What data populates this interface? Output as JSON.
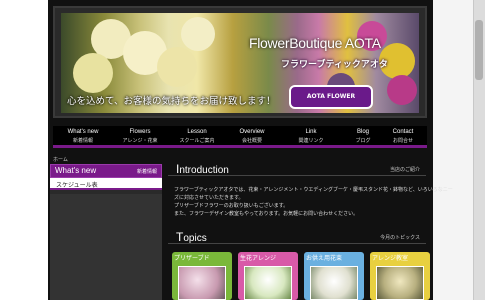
{
  "banner": {
    "title": "FlowerBoutique AOTA",
    "subtitle": "フラワーブティックアオタ",
    "slogan": "心を込めて、お客様の気持ちをお届け致します！",
    "badge": "AOTA FLOWER BOUTIQUE"
  },
  "nav": [
    {
      "en": "What's new",
      "jp": "新着情報"
    },
    {
      "en": "Flowers",
      "jp": "アレンジ・花束"
    },
    {
      "en": "Lesson",
      "jp": "スクールご案内"
    },
    {
      "en": "Overview",
      "jp": "会社概要"
    },
    {
      "en": "Link",
      "jp": "関連リンク"
    },
    {
      "en": "Blog",
      "jp": "ブログ"
    },
    {
      "en": "Contact",
      "jp": "お問合せ"
    }
  ],
  "breadcrumb": "ホーム",
  "sidebar": {
    "title": "What's new",
    "subtitle": "新着情報",
    "item": "スケジュール表"
  },
  "introduction": {
    "title": "Introduction",
    "link": "当店のご紹介",
    "lines": [
      "フラワーブティックアオタでは、花束・アレンジメント・ウエディングブーケ・慶弔スタンド花・鉢物など、いろいろなニー",
      "ズに対応させていただきます。",
      "プリザーブドフラワーのお取り扱いもございます。",
      "また、フラワーデザイン教室もやっております。お気軽にお問い合わせください。"
    ]
  },
  "topics": {
    "title": "Topics",
    "link": "今月のトピックス",
    "cards": [
      {
        "label": "プリザーブド",
        "color": "#7ab83a"
      },
      {
        "label": "生花アレンジ",
        "color": "#d85aa8"
      },
      {
        "label": "お供え用花束",
        "color": "#6ab0e0"
      },
      {
        "label": "アレンジ教室",
        "color": "#e8d040"
      }
    ]
  },
  "colors": {
    "accent": "#7a1a8a",
    "page_bg": "#111111"
  }
}
